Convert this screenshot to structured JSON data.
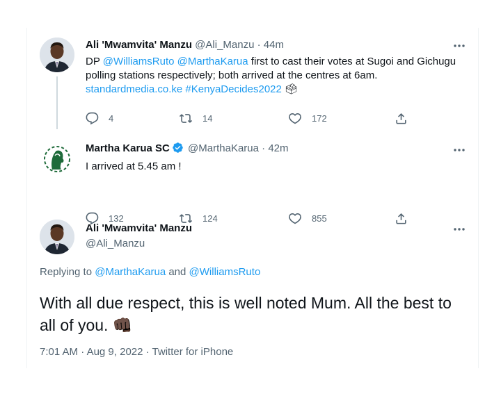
{
  "tweets": [
    {
      "name": "Ali 'Mwamvita' Manzu",
      "handle": "@Ali_Manzu",
      "dot": "·",
      "time": "44m",
      "body": {
        "t1": "DP ",
        "m1": "@WilliamsRuto",
        "t2": " ",
        "m2": "@MarthaKarua",
        "t3": " first to cast their votes at Sugoi and Gichugu polling stations respectively; both arrived at the centres at 6am.",
        "link": "standardmedia.co.ke",
        "t4": " ",
        "hashtag": "#KenyaDecides2022",
        "emoji": "🗳"
      },
      "replies": "4",
      "retweets": "14",
      "likes": "172"
    },
    {
      "name": "Martha Karua SC",
      "handle": "@MarthaKarua",
      "dot": "·",
      "time": "42m",
      "body": "I arrived at 5.45 am !",
      "replies": "132",
      "retweets": "124",
      "likes": "855"
    }
  ],
  "main": {
    "name": "Ali 'Mwamvita' Manzu",
    "handle": "@Ali_Manzu",
    "replying_prefix": "Replying to ",
    "replying_user1": "@MarthaKarua",
    "replying_and": " and ",
    "replying_user2": "@WilliamsRuto",
    "text": "With all due respect, this is well noted Mum. All the best to all of you.",
    "emoji": "👊🏿",
    "timestamp": "7:01 AM",
    "sep": "·",
    "date": "Aug 9, 2022",
    "source": "Twitter for iPhone"
  },
  "colors": {
    "link": "#1d9bf0",
    "secondary_text": "#536471",
    "verified": "#1d9bf0",
    "divider": "#eff3f4"
  },
  "icons": [
    "more-icon",
    "reply-icon",
    "retweet-icon",
    "like-icon",
    "share-icon",
    "verified-icon"
  ]
}
